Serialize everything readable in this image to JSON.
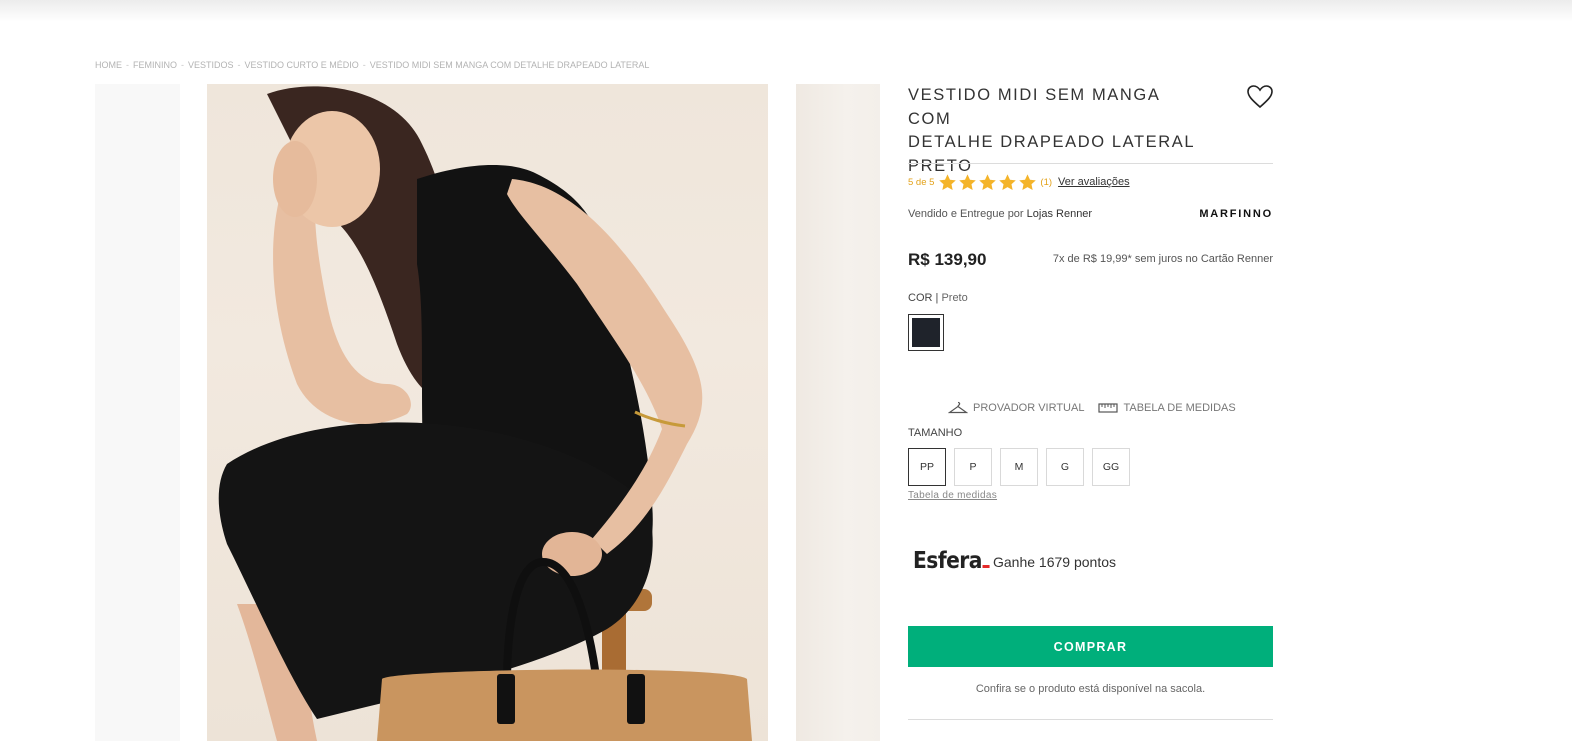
{
  "breadcrumb": [
    {
      "label": "HOME"
    },
    {
      "label": "FEMININO"
    },
    {
      "label": "VESTIDOS"
    },
    {
      "label": "VESTIDO CURTO E MÉDIO"
    },
    {
      "label": "VESTIDO MIDI SEM MANGA COM DETALHE DRAPEADO LATERAL"
    }
  ],
  "breadcrumb_separator": "-",
  "product": {
    "title_lines": [
      "VESTIDO MIDI SEM MANGA COM",
      "DETALHE DRAPEADO LATERAL",
      "PRETO"
    ],
    "favorite_icon": "heart-outline-icon",
    "rating": {
      "score_text": "5 de 5",
      "stars": 5,
      "max_stars": 5,
      "count_text": "(1)",
      "reviews_link": "Ver avaliações",
      "star_color": "#f4b42a"
    },
    "seller_prefix": "Vendido e Entregue por",
    "seller_name": "Lojas Renner",
    "brand": "MARFINNO",
    "price": "R$ 139,90",
    "installments": "7x de R$ 19,99* sem juros no Cartão Renner",
    "color_label": "COR",
    "color_separator": "|",
    "color_value": "Preto",
    "color_swatch_hex": "#1f232b",
    "virtual_fitting": "PROVADOR VIRTUAL",
    "measurements_table": "TABELA DE MEDIDAS",
    "size_label": "TAMANHO",
    "sizes": [
      "PP",
      "P",
      "M",
      "G",
      "GG"
    ],
    "selected_size": "PP",
    "size_chart_link": "Tabela de medidas",
    "esfera_logo": "Esfera",
    "esfera_points": "Ganhe 1679 pontos",
    "buy_button": "COMPRAR",
    "buy_button_color": "#00af7b",
    "bag_note": "Confira se o produto está disponível na sacola."
  }
}
